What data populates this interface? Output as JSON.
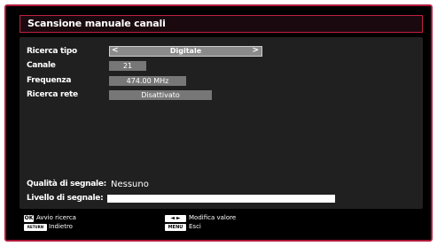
{
  "window": {
    "title": "Scansione manuale canali"
  },
  "settings": {
    "search_type": {
      "label": "Ricerca tipo",
      "value": "Digitale"
    },
    "channel": {
      "label": "Canale",
      "value": "21"
    },
    "frequency": {
      "label": "Frequenza",
      "value": "474.00 MHz"
    },
    "network_search": {
      "label": "Ricerca rete",
      "value": "Disattivato"
    }
  },
  "signal": {
    "quality_label": "Qualità di segnale:",
    "quality_value": "Nessuno",
    "level_label": "Livello di segnale:",
    "level_fraction": 1.0
  },
  "footer": {
    "ok_key": "OK",
    "ok_label": "Avvio ricerca",
    "back_key": "RETURN",
    "back_label": "Indietro",
    "arrows_key": "◄ ►",
    "arrows_label": "Modifica valore",
    "menu_key": "MENU",
    "menu_label": "Esci"
  },
  "colors": {
    "frame": "#b01a3a",
    "panel": "#202020",
    "value_box": "#777777"
  }
}
